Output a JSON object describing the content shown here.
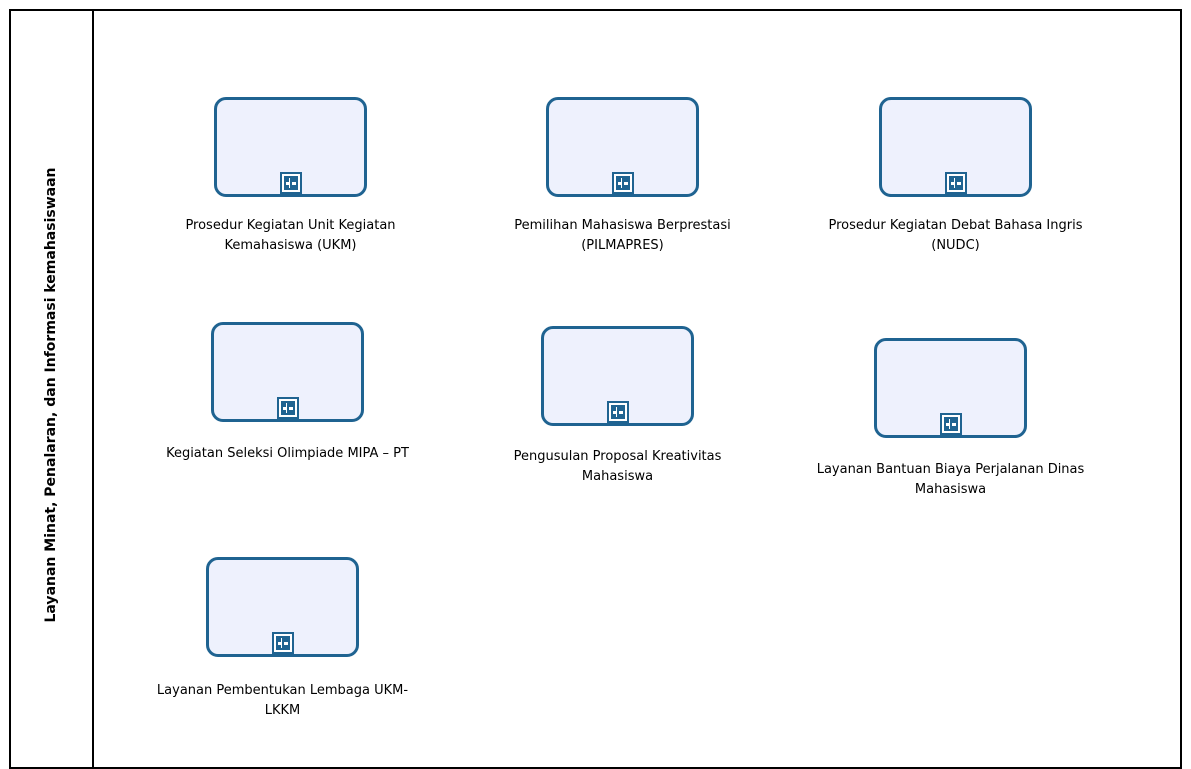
{
  "lane": {
    "title": "Layanan Minat, Penalaran, dan Informasi kemahasiswaan"
  },
  "tasks": [
    {
      "label": "Prosedur Kegiatan Unit Kegiatan Kemahasiswa (UKM)"
    },
    {
      "label": "Pemilihan Mahasiswa Berprestasi (PILMAPRES)"
    },
    {
      "label": "Prosedur Kegiatan Debat Bahasa Ingris (NUDC)"
    },
    {
      "label": "Kegiatan Seleksi Olimpiade MIPA – PT"
    },
    {
      "label": "Pengusulan Proposal Kreativitas Mahasiswa"
    },
    {
      "label": "Layanan Bantuan Biaya Perjalanan Dinas Mahasiswa"
    },
    {
      "label": "Layanan Pembentukan Lembaga UKM-LKKM"
    }
  ],
  "colors": {
    "task_border": "#1f6391",
    "task_fill": "#eef1fd"
  },
  "icons": {
    "subprocess_marker": "plus-square-icon"
  }
}
